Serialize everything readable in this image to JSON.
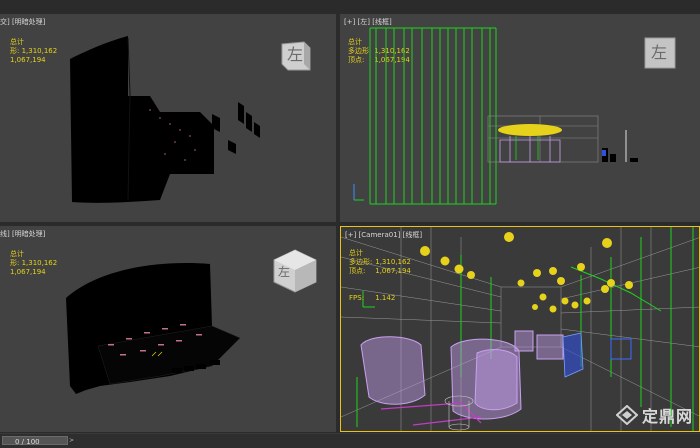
{
  "viewports": {
    "top_left": {
      "label": "交] [明暗处理]",
      "stats": {
        "total_label": "总计",
        "polys_label": "形:",
        "polys_value": "1,310,162",
        "verts_value": "1,067,194"
      },
      "cube_letter": "左"
    },
    "top_right": {
      "label": "[+] [左] [线框]",
      "stats": {
        "total_label": "总计",
        "polys_label": "多边形:",
        "polys_value": "1,310,162",
        "verts_label": "顶点:",
        "verts_value": "1,067,194"
      },
      "cube_letter": "左"
    },
    "bottom_left": {
      "label": "线] [明暗处理]",
      "stats": {
        "total_label": "总计",
        "polys_label": "形:",
        "polys_value": "1,310,162",
        "verts_value": "1,067,194"
      },
      "cube_letter": "左"
    },
    "bottom_right": {
      "label": "[+] [Camera01] [线框]",
      "stats": {
        "total_label": "总计",
        "polys_label": "多边形:",
        "polys_value": "1,310,162",
        "verts_label": "顶点:",
        "verts_value": "1,067,194",
        "fps_label": "FPS:",
        "fps_value": "1.142"
      }
    }
  },
  "timeline": {
    "frame_text": "0 / 100",
    "next_arrow": ">"
  },
  "watermark": {
    "text": "定鼎网",
    "icon": "diamond-logo-icon"
  },
  "colors": {
    "viewport_bg": "#424242",
    "active_border": "#e8c41a",
    "stats_text": "#e6d21a",
    "wire_green": "#1fd11f",
    "wire_violet": "#c8a0f0"
  }
}
